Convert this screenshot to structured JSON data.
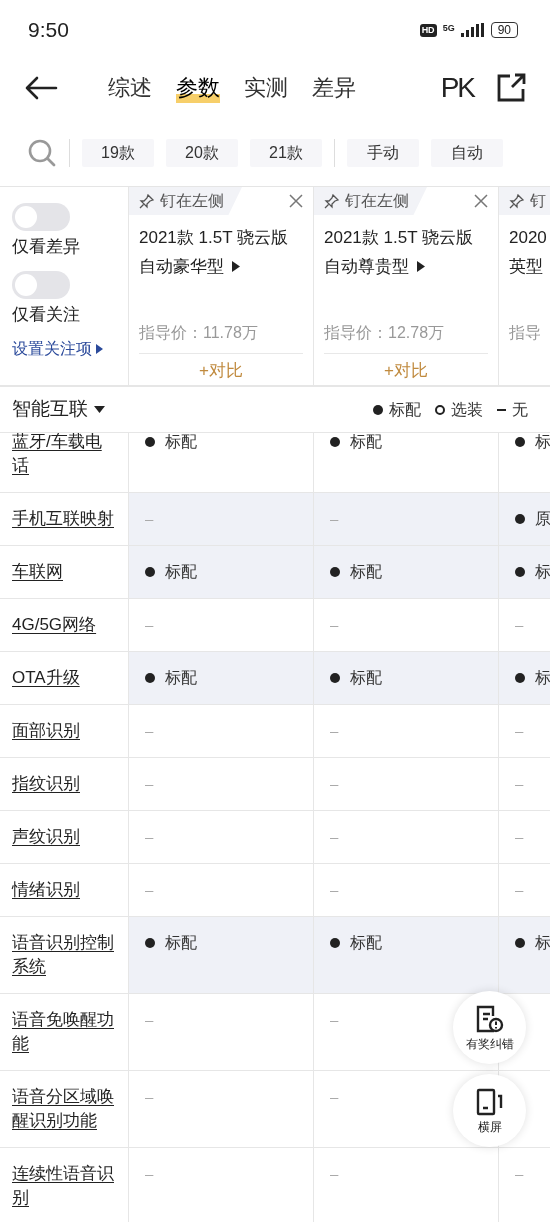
{
  "status_bar": {
    "time": "9:50",
    "hd": "HD",
    "network": "5G",
    "battery": "90"
  },
  "nav": {
    "tabs": [
      {
        "label": "综述",
        "selected": false
      },
      {
        "label": "参数",
        "selected": true
      },
      {
        "label": "实测",
        "selected": false
      },
      {
        "label": "差异",
        "selected": false
      }
    ],
    "pk": "PK"
  },
  "filters": {
    "groups": [
      [
        {
          "label": "19款",
          "selected": false
        },
        {
          "label": "20款",
          "selected": false
        },
        {
          "label": "21款",
          "selected": false
        }
      ],
      [
        {
          "label": "手动",
          "selected": false
        },
        {
          "label": "自动",
          "selected": false
        }
      ]
    ]
  },
  "side": {
    "toggles": [
      {
        "label": "仅看差异",
        "on": false
      },
      {
        "label": "仅看关注",
        "on": false
      }
    ],
    "link": "设置关注项"
  },
  "cars": [
    {
      "pin": "钉在左侧",
      "title": [
        "2021款 1.5T 骁云版",
        "自动豪华型"
      ],
      "price": "指导价：11.78万",
      "compare": "+对比"
    },
    {
      "pin": "钉在左侧",
      "title": [
        "2021款 1.5T 骁云版",
        "自动尊贵型"
      ],
      "price": "指导价：12.78万",
      "compare": "+对比"
    },
    {
      "pin": "钉",
      "title": [
        "2020",
        "英型"
      ],
      "price": "指导"
    }
  ],
  "section": {
    "title": "智能互联",
    "legend": [
      {
        "kind": "standard",
        "label": "标配"
      },
      {
        "kind": "optional",
        "label": "选装"
      },
      {
        "kind": "none",
        "label": "无"
      }
    ]
  },
  "rows": [
    {
      "label": "蓝牙/车载电话",
      "highlighted": false,
      "cells": [
        {
          "kind": "standard",
          "text": "标配"
        },
        {
          "kind": "standard",
          "text": "标配"
        },
        {
          "kind": "standard",
          "text": "标"
        }
      ]
    },
    {
      "label": "手机互联映射",
      "highlighted": true,
      "cells": [
        {
          "kind": "none",
          "text": "–"
        },
        {
          "kind": "none",
          "text": "–"
        },
        {
          "kind": "standard",
          "text": "原"
        }
      ]
    },
    {
      "label": "车联网",
      "highlighted": true,
      "cells": [
        {
          "kind": "standard",
          "text": "标配"
        },
        {
          "kind": "standard",
          "text": "标配"
        },
        {
          "kind": "standard",
          "text": "标"
        }
      ]
    },
    {
      "label": "4G/5G网络",
      "highlighted": false,
      "cells": [
        {
          "kind": "none",
          "text": "–"
        },
        {
          "kind": "none",
          "text": "–"
        },
        {
          "kind": "none",
          "text": "–"
        }
      ]
    },
    {
      "label": "OTA升级",
      "highlighted": true,
      "cells": [
        {
          "kind": "standard",
          "text": "标配"
        },
        {
          "kind": "standard",
          "text": "标配"
        },
        {
          "kind": "standard",
          "text": "标"
        }
      ]
    },
    {
      "label": "面部识别",
      "highlighted": false,
      "cells": [
        {
          "kind": "none",
          "text": "–"
        },
        {
          "kind": "none",
          "text": "–"
        },
        {
          "kind": "none",
          "text": "–"
        }
      ]
    },
    {
      "label": "指纹识别",
      "highlighted": false,
      "cells": [
        {
          "kind": "none",
          "text": "–"
        },
        {
          "kind": "none",
          "text": "–"
        },
        {
          "kind": "none",
          "text": "–"
        }
      ]
    },
    {
      "label": "声纹识别",
      "highlighted": false,
      "cells": [
        {
          "kind": "none",
          "text": "–"
        },
        {
          "kind": "none",
          "text": "–"
        },
        {
          "kind": "none",
          "text": "–"
        }
      ]
    },
    {
      "label": "情绪识别",
      "highlighted": false,
      "cells": [
        {
          "kind": "none",
          "text": "–"
        },
        {
          "kind": "none",
          "text": "–"
        },
        {
          "kind": "none",
          "text": "–"
        }
      ]
    },
    {
      "label": "语音识别控制系统",
      "highlighted": true,
      "cells": [
        {
          "kind": "standard",
          "text": "标配"
        },
        {
          "kind": "standard",
          "text": "标配"
        },
        {
          "kind": "standard",
          "text": "标"
        }
      ]
    },
    {
      "label": "语音免唤醒功能",
      "highlighted": false,
      "cells": [
        {
          "kind": "none",
          "text": "–"
        },
        {
          "kind": "none",
          "text": "–"
        }
      ]
    },
    {
      "label": "语音分区域唤醒识别功能",
      "highlighted": false,
      "cells": [
        {
          "kind": "none",
          "text": "–"
        },
        {
          "kind": "none",
          "text": "–"
        }
      ]
    },
    {
      "label": "连续性语音识别",
      "highlighted": false,
      "cells": [
        {
          "kind": "none",
          "text": "–"
        },
        {
          "kind": "none",
          "text": "–"
        },
        {
          "kind": "none",
          "text": "–"
        }
      ]
    }
  ],
  "floating": [
    {
      "kind": "report",
      "label": "有奖纠错"
    },
    {
      "kind": "rotate",
      "label": "横屏"
    }
  ]
}
